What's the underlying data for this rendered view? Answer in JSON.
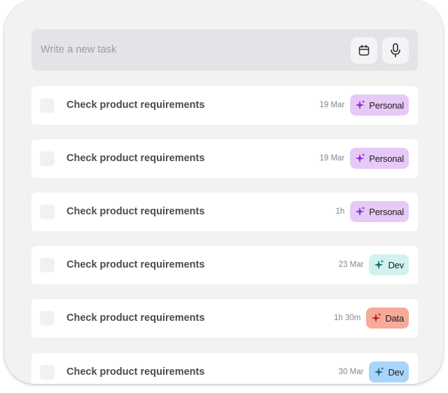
{
  "composer": {
    "placeholder": "Write a new task",
    "calendar_icon": "calendar-icon",
    "mic_icon": "microphone-icon"
  },
  "tasks": [
    {
      "title": "Check product requirements",
      "date": "19 Mar",
      "tag": "Personal",
      "tag_bg": "#e6c9f7",
      "tag_icon_color": "#8a2be2"
    },
    {
      "title": "Check product requirements",
      "date": "19 Mar",
      "tag": "Personal",
      "tag_bg": "#e6c9f7",
      "tag_icon_color": "#8a2be2"
    },
    {
      "title": "Check product requirements",
      "date": "1h",
      "tag": "Personal",
      "tag_bg": "#e6c9f7",
      "tag_icon_color": "#8a2be2"
    },
    {
      "title": "Check product requirements",
      "date": "23 Mar",
      "tag": "Dev",
      "tag_bg": "#d2f2ef",
      "tag_icon_color": "#1c6b73"
    },
    {
      "title": "Check product requirements",
      "date": "1h 30m",
      "tag": "Data",
      "tag_bg": "#f7a99a",
      "tag_icon_color": "#b3261e"
    },
    {
      "title": "Check product requirements",
      "date": "30 Mar",
      "tag": "Dev",
      "tag_bg": "#a9d4fb",
      "tag_icon_color": "#1c6b73"
    }
  ],
  "colors": {
    "frame_bg": "#f2f2f3",
    "input_bg": "#e3e4e7",
    "card_bg": "#ffffff",
    "title_text": "#4b4b50",
    "meta_text": "#85868b"
  }
}
